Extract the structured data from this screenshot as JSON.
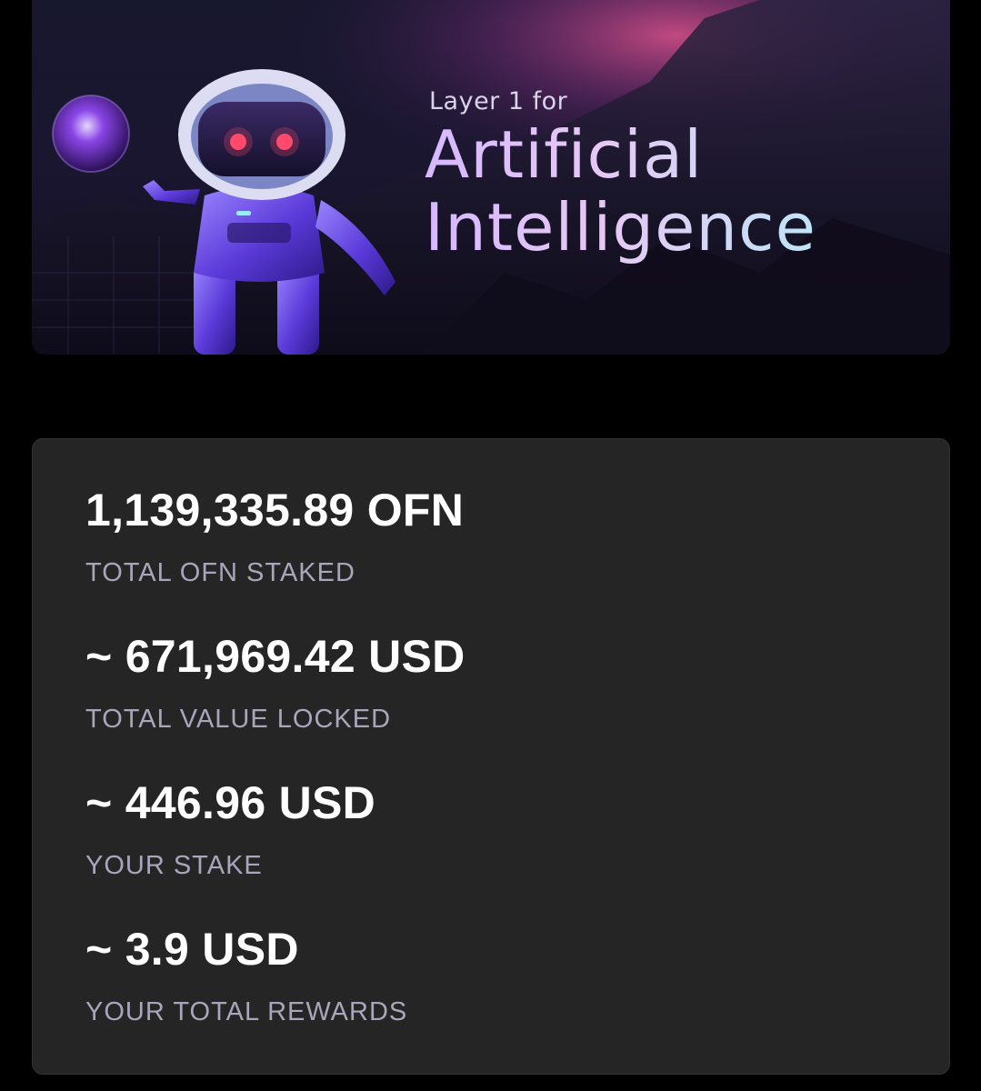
{
  "banner": {
    "subtitle": "Layer 1 for",
    "title_line1": "Artificial",
    "title_line2": "Intelligence"
  },
  "stats": [
    {
      "value": "1,139,335.89 OFN",
      "label": "TOTAL OFN STAKED"
    },
    {
      "value": "~ 671,969.42 USD",
      "label": "TOTAL VALUE LOCKED"
    },
    {
      "value": "~ 446.96 USD",
      "label": "YOUR STAKE"
    },
    {
      "value": "~ 3.9 USD",
      "label": "YOUR TOTAL REWARDS"
    }
  ],
  "colors": {
    "background": "#000000",
    "card": "#252525",
    "value_text": "#ffffff",
    "label_text": "#a9a6bb",
    "accent_purple": "#6a4cf0"
  }
}
